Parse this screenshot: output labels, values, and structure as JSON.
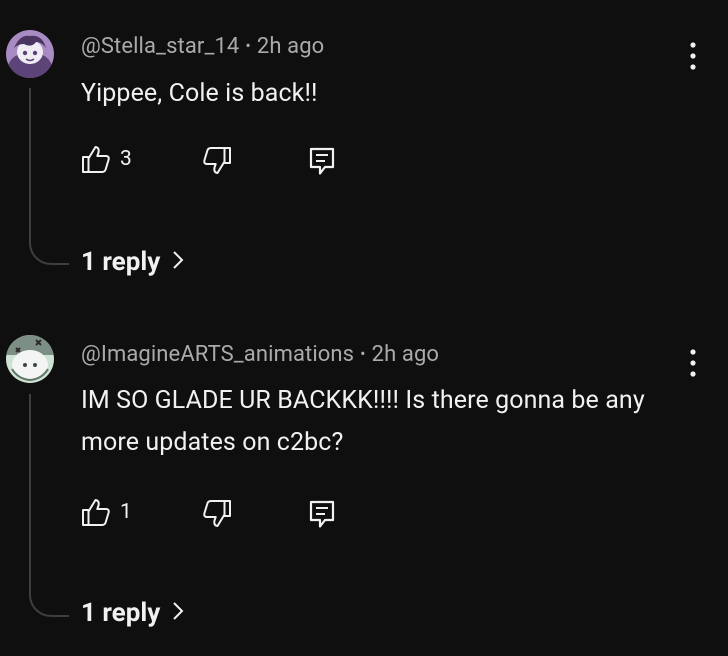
{
  "comments": [
    {
      "username": "@Stella_star_14",
      "separator": "•",
      "time": "2h ago",
      "text": "Yippee, Cole is back!!",
      "likes": "3",
      "replies_label": "1 reply"
    },
    {
      "username": "@ImagineARTS_animations",
      "separator": "•",
      "time": "2h ago",
      "text": "IM SO GLADE UR BACKKK!!!! Is there gonna be any more updates on c2bc?",
      "likes": "1",
      "replies_label": "1 reply"
    }
  ],
  "colors": {
    "background": "#0f0f0f",
    "text_primary": "#f1f1f1",
    "text_secondary": "#aaaaaa",
    "thread_line": "#3e3e3e"
  },
  "icons": {
    "like": "thumbs-up-icon",
    "dislike": "thumbs-down-icon",
    "reply": "reply-icon",
    "more": "more-vertical-icon",
    "expand": "chevron-right-icon"
  }
}
